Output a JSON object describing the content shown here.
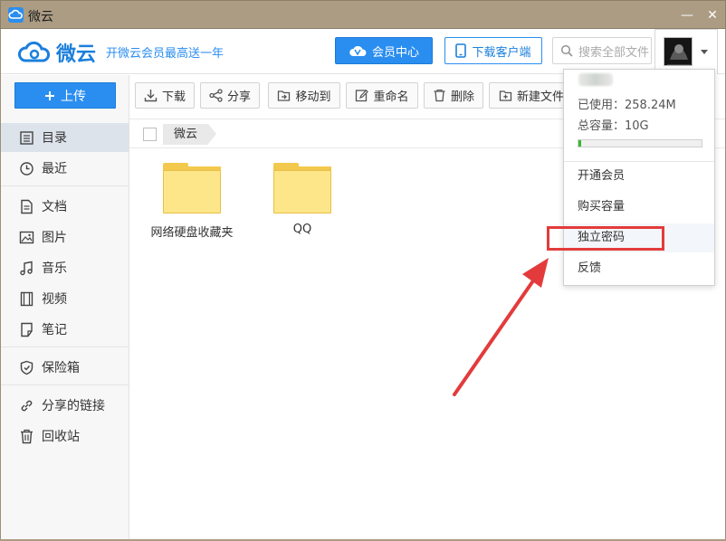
{
  "window": {
    "title": "微云",
    "minimize": "—",
    "close": "✕"
  },
  "header": {
    "logo_text": "微云",
    "slogan": "开微云会员最高送一年",
    "vip_button": "会员中心",
    "client_button": "下载客户端",
    "search_placeholder": "搜索全部文件"
  },
  "sidebar": {
    "upload": "上传",
    "items": [
      {
        "label": "目录",
        "icon": "directory-icon"
      },
      {
        "label": "最近",
        "icon": "clock-icon"
      },
      {
        "label": "文档",
        "icon": "document-icon"
      },
      {
        "label": "图片",
        "icon": "image-icon"
      },
      {
        "label": "音乐",
        "icon": "music-icon"
      },
      {
        "label": "视频",
        "icon": "video-icon"
      },
      {
        "label": "笔记",
        "icon": "note-icon"
      },
      {
        "label": "保险箱",
        "icon": "shield-icon"
      },
      {
        "label": "分享的链接",
        "icon": "share-link-icon"
      },
      {
        "label": "回收站",
        "icon": "trash-icon"
      }
    ]
  },
  "toolbar": {
    "download": "下载",
    "share": "分享",
    "move": "移动到",
    "rename": "重命名",
    "delete": "删除",
    "new_folder": "新建文件"
  },
  "breadcrumb": {
    "root": "微云"
  },
  "files": [
    {
      "name": "网络硬盘收藏夹",
      "type": "folder"
    },
    {
      "name": "QQ",
      "type": "folder"
    }
  ],
  "account_menu": {
    "used_label": "已使用：",
    "used_value": "258.24M",
    "total_label": "总容量：",
    "total_value": "10G",
    "quota_fraction": 0.025,
    "items": [
      "开通会员",
      "购买容量",
      "独立密码",
      "反馈"
    ]
  },
  "colors": {
    "accent": "#2a8ef0",
    "highlight_box": "#e33b3b",
    "quota_fill": "#3cb832",
    "folder": "#fde68a"
  }
}
